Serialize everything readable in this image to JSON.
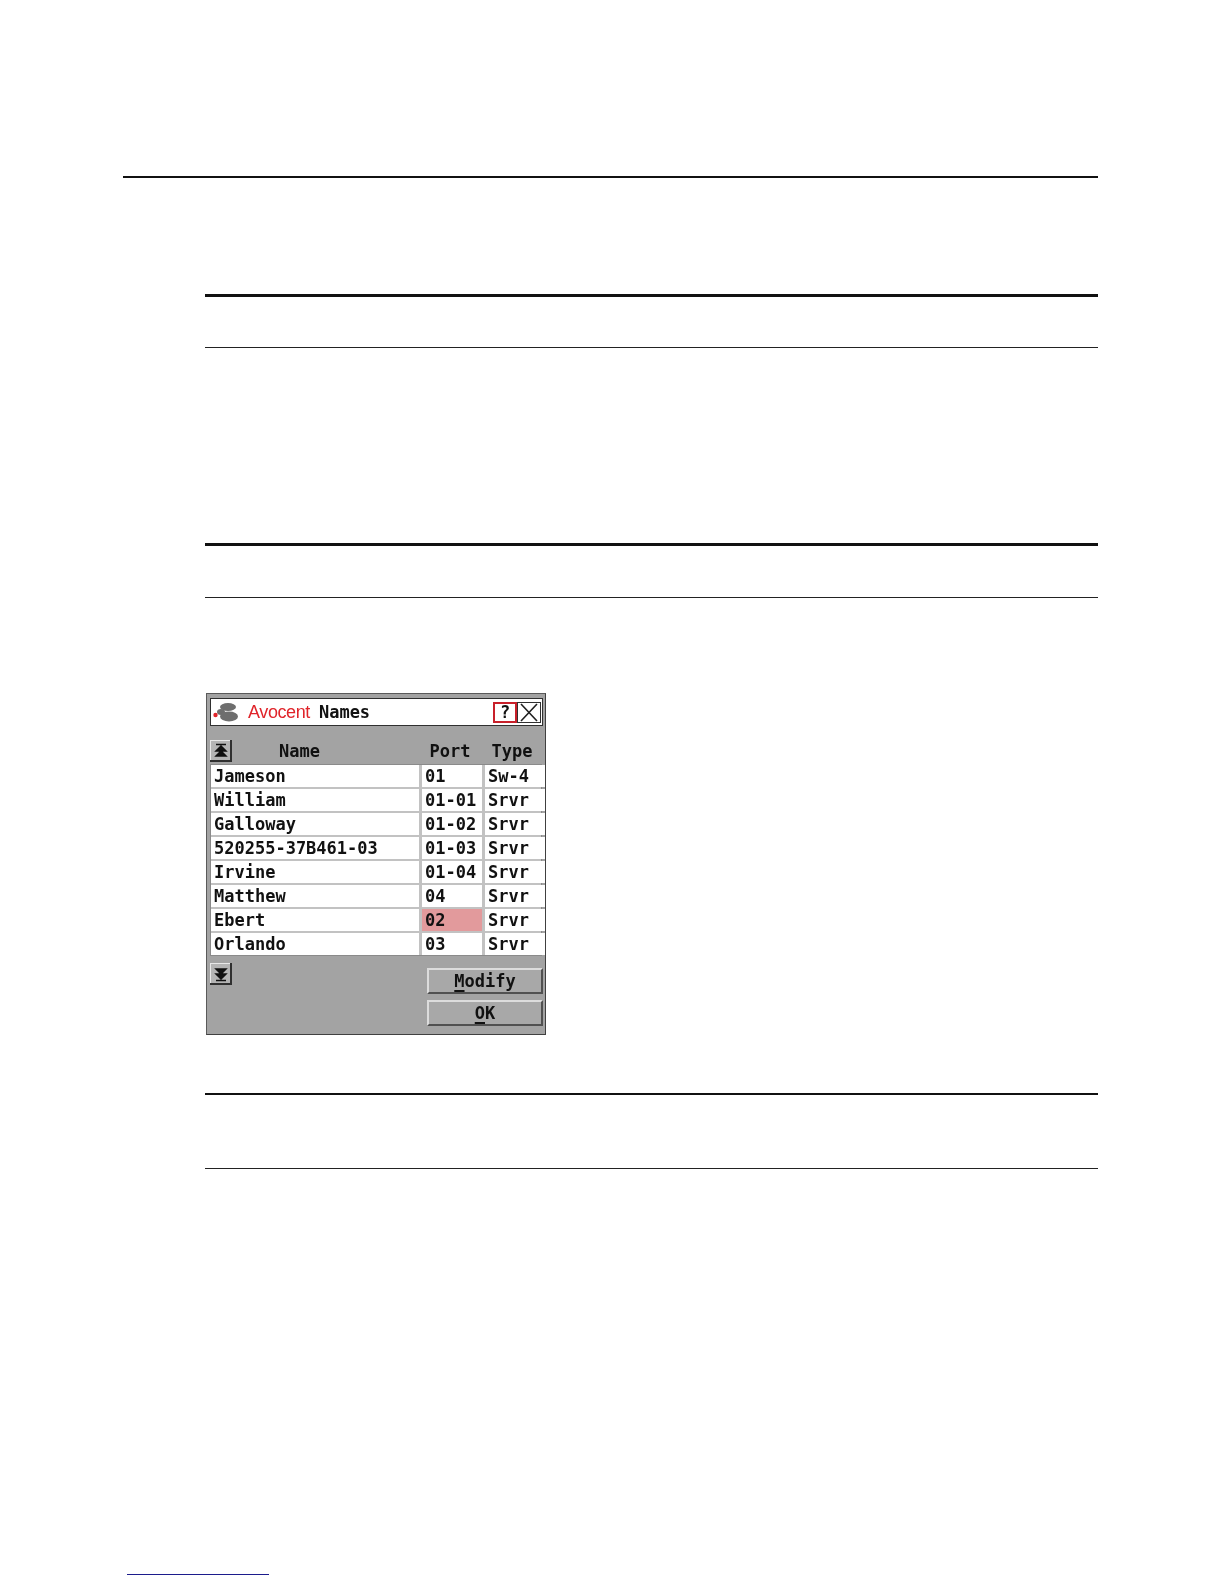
{
  "dialog": {
    "brand": "Avocent",
    "title": "Names",
    "help_button": "?",
    "columns": [
      "Name",
      "Port",
      "Type"
    ],
    "rows": [
      {
        "name": "Jameson",
        "port": "01",
        "type": "Sw-4",
        "selected": false
      },
      {
        "name": "William",
        "port": "01-01",
        "type": "Srvr",
        "selected": false
      },
      {
        "name": "Galloway",
        "port": "01-02",
        "type": "Srvr",
        "selected": false
      },
      {
        "name": "520255-37B461-03",
        "port": "01-03",
        "type": "Srvr",
        "selected": false
      },
      {
        "name": "Irvine",
        "port": "01-04",
        "type": "Srvr",
        "selected": false
      },
      {
        "name": "Matthew",
        "port": "04",
        "type": "Srvr",
        "selected": false
      },
      {
        "name": "Ebert",
        "port": "02",
        "type": "Srvr",
        "selected": true
      },
      {
        "name": "Orlando",
        "port": "03",
        "type": "Srvr",
        "selected": false
      }
    ],
    "buttons": [
      {
        "label": "Modify",
        "mnemonic": true
      },
      {
        "label": "OK",
        "mnemonic": true
      }
    ]
  }
}
